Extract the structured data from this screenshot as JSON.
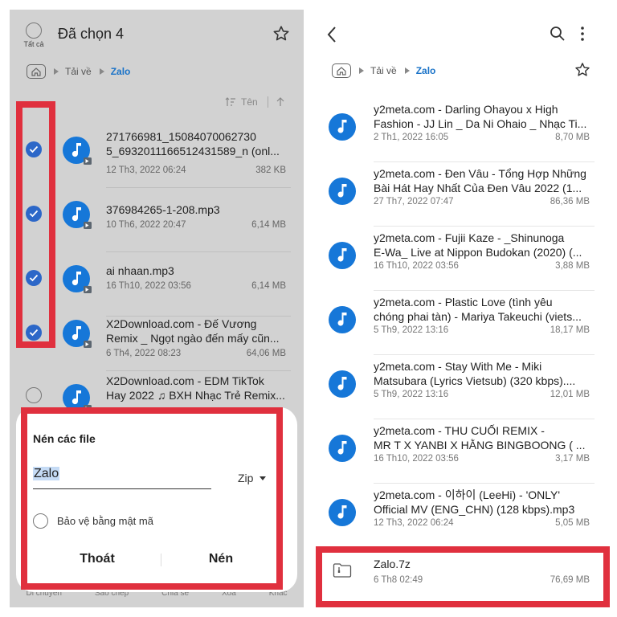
{
  "left": {
    "select_all_label": "Tất cả",
    "title": "Đã chọn 4",
    "breadcrumb": {
      "parent": "Tải về",
      "current": "Zalo"
    },
    "sort_label": "Tên",
    "files": [
      {
        "lines": [
          "271766981_15084070062730",
          "5_6932011166512431589_n (onl..."
        ],
        "date": "12 Th3, 2022 06:24",
        "size": "382 KB",
        "checked": true
      },
      {
        "lines": [
          "376984265-1-208.mp3"
        ],
        "date": "10 Th6, 2022 20:47",
        "size": "6,14 MB",
        "checked": true
      },
      {
        "lines": [
          "ai nhaan.mp3"
        ],
        "date": "16 Th10, 2022 03:56",
        "size": "6,14 MB",
        "checked": true
      },
      {
        "lines": [
          "X2Download.com - Đế Vương",
          "Remix _ Ngọt ngào đến mấy cũn..."
        ],
        "date": "6 Th4, 2022 08:23",
        "size": "64,06 MB",
        "checked": true
      },
      {
        "lines": [
          "X2Download.com - EDM TikTok",
          "Hay 2022 ♫ BXH Nhạc Trẻ Remix..."
        ],
        "date": "",
        "size": "",
        "checked": false
      }
    ],
    "bottom_nav": [
      "Di chuyển",
      "Sao chép",
      "Chia sẻ",
      "Xoá",
      "Khác"
    ]
  },
  "dialog": {
    "title": "Nén các file",
    "filename": "Zalo",
    "format": "Zip",
    "password_label": "Bảo vệ bằng mật mã",
    "cancel": "Thoát",
    "confirm": "Nén"
  },
  "right": {
    "breadcrumb": {
      "parent": "Tải về",
      "current": "Zalo"
    },
    "files": [
      {
        "lines": [
          "y2meta.com - Darling Ohayou x High",
          "Fashion - JJ Lin _ Da Ni Ohaio _ Nhạc Ti..."
        ],
        "date": "2 Th1, 2022 16:05",
        "size": "8,70 MB"
      },
      {
        "lines": [
          "y2meta.com - Đen Vâu - Tổng Hợp Những",
          "Bài Hát Hay Nhất Của Đen Vâu 2022 (1..."
        ],
        "date": "27 Th7, 2022 07:47",
        "size": "86,36 MB"
      },
      {
        "lines": [
          "y2meta.com - Fujii Kaze - _Shinunoga",
          "E-Wa_ Live at Nippon Budokan (2020) (..."
        ],
        "date": "16 Th10, 2022 03:56",
        "size": "3,88 MB"
      },
      {
        "lines": [
          "y2meta.com - Plastic Love (tình yêu",
          "chóng phai tàn) - Mariya Takeuchi (viets..."
        ],
        "date": "5 Th9, 2022 13:16",
        "size": "18,17 MB"
      },
      {
        "lines": [
          "y2meta.com - Stay With Me - Miki",
          "Matsubara (Lyrics Vietsub) (320 kbps)...."
        ],
        "date": "5 Th9, 2022 13:16",
        "size": "12,01 MB"
      },
      {
        "lines": [
          "y2meta.com - THU CUỐI REMIX -",
          "MR T X YANBI X HẰNG BINGBOONG ( ..."
        ],
        "date": "16 Th10, 2022 03:56",
        "size": "3,17 MB"
      },
      {
        "lines": [
          "y2meta.com - 이하이 (LeeHi) - 'ONLY'",
          "Official MV (ENG_CHN) (128 kbps).mp3"
        ],
        "date": "12 Th3, 2022 06:24",
        "size": "5,05 MB"
      }
    ],
    "zip": {
      "name": "Zalo.7z",
      "date": "6 Th8 02:49",
      "size": "76,69 MB"
    }
  },
  "colors": {
    "accent": "#1a73c8",
    "icon_blue": "#1677d8",
    "highlight": "#e0303e"
  }
}
